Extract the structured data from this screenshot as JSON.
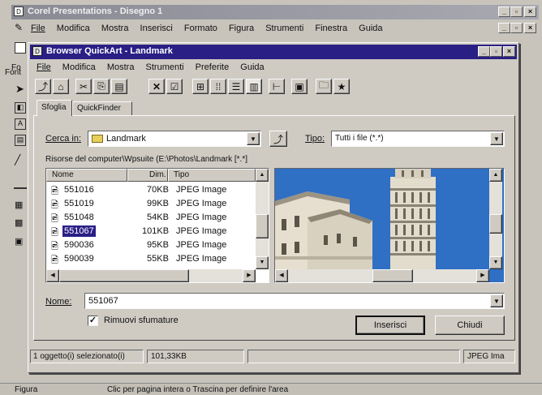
{
  "outer_app": {
    "title": "Corel Presentations - Disegno 1",
    "menu": [
      "File",
      "Modifica",
      "Mostra",
      "Inserisci",
      "Formato",
      "Figura",
      "Strumenti",
      "Finestra",
      "Guida"
    ],
    "left_label_1": "Fo",
    "left_label_2": "Font",
    "status_left": "Figura",
    "status_hint": "Clic per pagina intera o Trascina per definire l'area"
  },
  "dialog": {
    "title": "Browser QuickArt - Landmark",
    "menu": [
      "File",
      "Modifica",
      "Mostra",
      "Strumenti",
      "Preferite",
      "Guida"
    ],
    "tabs": [
      "Sfoglia",
      "QuickFinder"
    ],
    "look_in_label": "Cerca in:",
    "look_in_value": "Landmark",
    "type_label": "Tipo:",
    "type_value": "Tutti i file (*.*)",
    "resources_label": "Risorse del computer\\Wpsuite (E:\\Photos\\Landmark  [*.*]",
    "columns": [
      "Nome",
      "Dim.",
      "Tipo"
    ],
    "files": [
      {
        "name": "551016",
        "size": "70KB",
        "type": "JPEG Image"
      },
      {
        "name": "551019",
        "size": "99KB",
        "type": "JPEG Image"
      },
      {
        "name": "551048",
        "size": "54KB",
        "type": "JPEG Image"
      },
      {
        "name": "551067",
        "size": "101KB",
        "type": "JPEG Image",
        "selected": true
      },
      {
        "name": "590036",
        "size": "95KB",
        "type": "JPEG Image"
      },
      {
        "name": "590039",
        "size": "55KB",
        "type": "JPEG Image"
      }
    ],
    "name_label": "Nome:",
    "name_value": "551067",
    "remove_label": "Rimuovi sfumature",
    "remove_checked": true,
    "insert_button": "Inserisci",
    "close_button": "Chiudi",
    "status_selected": "1 oggetto(i) selezionato(i)",
    "status_size": "101,33KB",
    "status_type": "JPEG Ima"
  },
  "colors": {
    "titlebar": "#2a1f85",
    "selection": "#2a1f85",
    "sky": "#2f6fc4"
  }
}
